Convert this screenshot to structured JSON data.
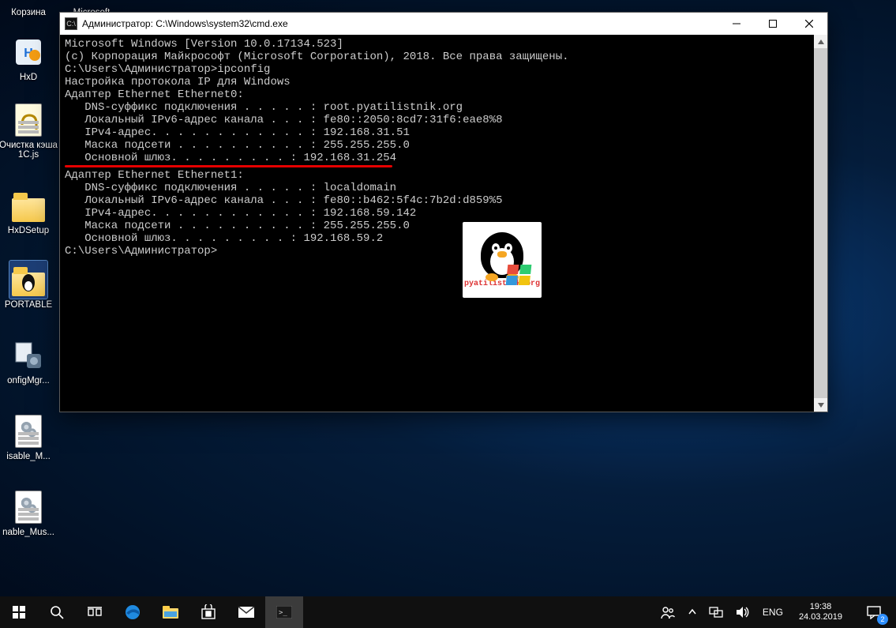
{
  "desktop_icons": {
    "korzina": "Корзина",
    "microsoft": "Microsoft",
    "hxd": "HxD",
    "ochistka": "Очистка кэша 1C.js",
    "hxdsetup": "HxDSetup",
    "portable": "PORTABLE",
    "configmgr": "onfigMgr...",
    "disable_m": "isable_M...",
    "nable_mus": "nable_Mus..."
  },
  "window": {
    "title": "Администратор: C:\\Windows\\system32\\cmd.exe",
    "icon_text": "C:\\"
  },
  "cmd": {
    "l1": "Microsoft Windows [Version 10.0.17134.523]",
    "l2": "(c) Корпорация Майкрософт (Microsoft Corporation), 2018. Все права защищены.",
    "blank": "",
    "prompt1": "C:\\Users\\Администратор>ipconfig",
    "cfg_header": "Настройка протокола IP для Windows",
    "adapter0_hdr": "Адаптер Ethernet Ethernet0:",
    "a0_dns": "   DNS-суффикс подключения . . . . . : root.pyatilistnik.org",
    "a0_ipv6": "   Локальный IPv6-адрес канала . . . : fe80::2050:8cd7:31f6:eae8%8",
    "a0_ipv4": "   IPv4-адрес. . . . . . . . . . . . : 192.168.31.51",
    "a0_mask": "   Маска подсети . . . . . . . . . . : 255.255.255.0",
    "a0_gw": "   Основной шлюз. . . . . . . . . : 192.168.31.254",
    "adapter1_hdr": "Адаптер Ethernet Ethernet1:",
    "a1_dns": "   DNS-суффикс подключения . . . . . : localdomain",
    "a1_ipv6": "   Локальный IPv6-адрес канала . . . : fe80::b462:5f4c:7b2d:d859%5",
    "a1_ipv4": "   IPv4-адрес. . . . . . . . . . . . : 192.168.59.142",
    "a1_mask": "   Маска подсети . . . . . . . . . . : 255.255.255.0",
    "a1_gw": "   Основной шлюз. . . . . . . . . : 192.168.59.2",
    "prompt2": "C:\\Users\\Администратор>"
  },
  "overlay_caption": "pyatilistnik.org",
  "taskbar": {
    "lang": "ENG",
    "time": "19:38",
    "date": "24.03.2019",
    "notifications": "2"
  }
}
